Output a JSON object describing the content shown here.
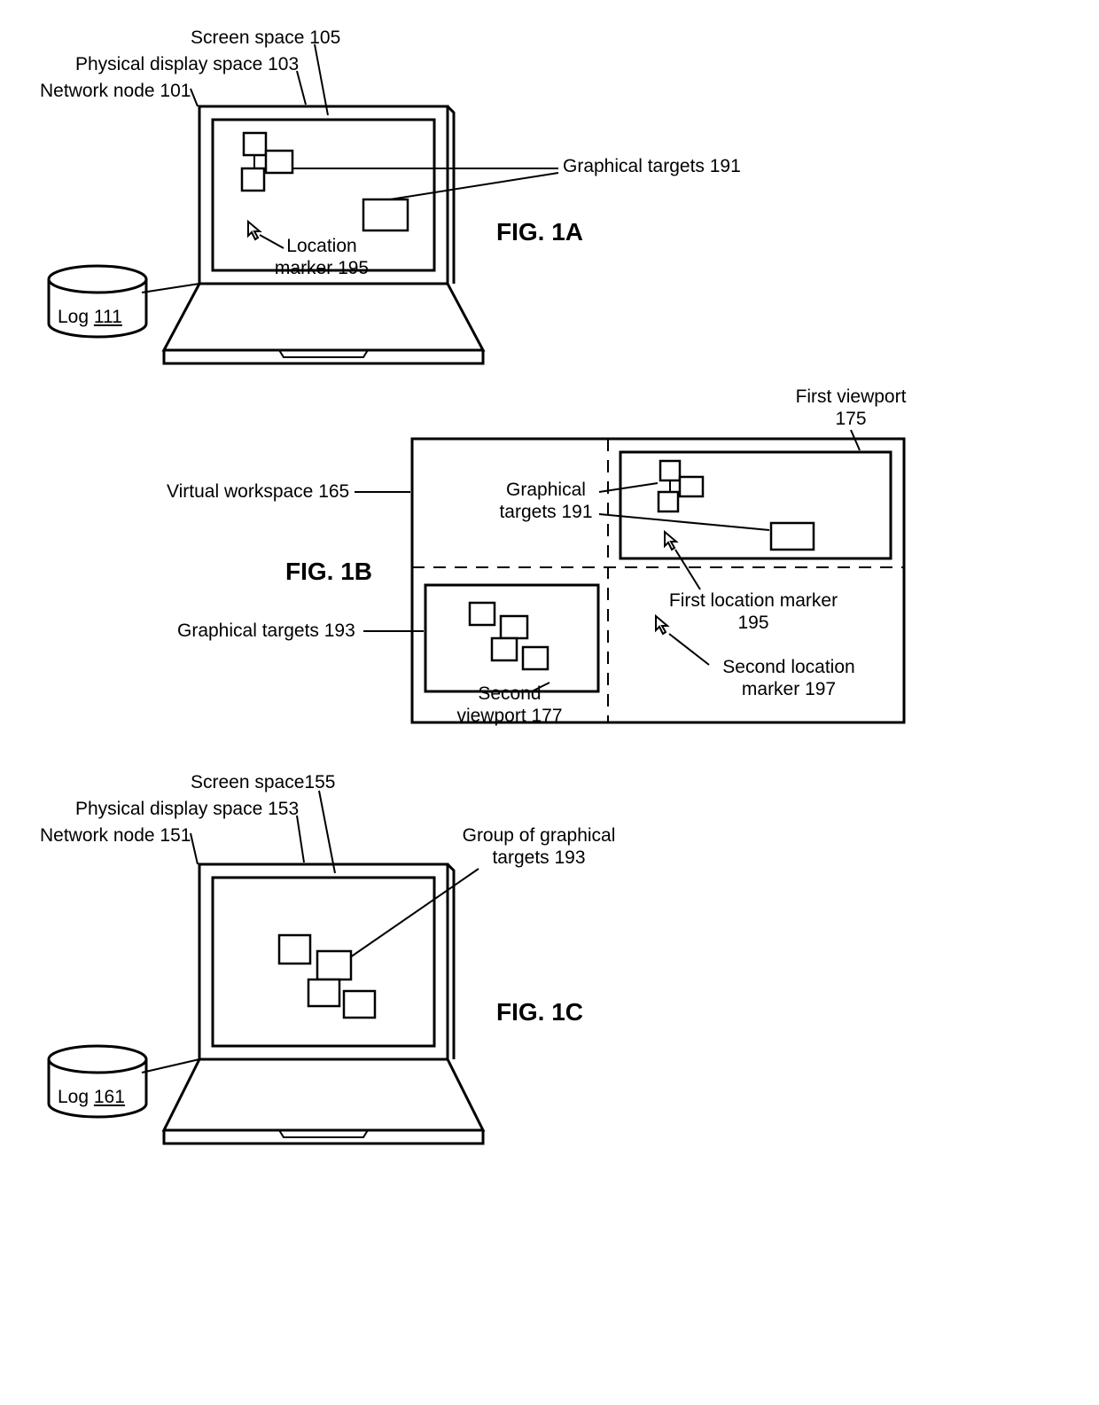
{
  "figA": {
    "title": "FIG. 1A",
    "labels": {
      "screen_space": "Screen space 105",
      "phys_display": "Physical display space 103",
      "net_node": "Network node 101",
      "graph_targets": "Graphical targets 191",
      "loc_marker_line1": "Location",
      "loc_marker_line2": "marker 195",
      "log_text": "Log ",
      "log_num": "111"
    }
  },
  "figB": {
    "title": "FIG. 1B",
    "labels": {
      "first_vp_line1": "First viewport",
      "first_vp_line2": "175",
      "virtual_ws": "Virtual workspace 165",
      "graph_targets191_line1": "Graphical",
      "graph_targets191_line2": "targets 191",
      "graph_targets193": "Graphical targets 193",
      "second_vp_line1": "Second",
      "second_vp_line2": "viewport 177",
      "first_loc_line1": "First location marker",
      "first_loc_line2": "195",
      "second_loc_line1": "Second location",
      "second_loc_line2": "marker 197"
    }
  },
  "figC": {
    "title": "FIG. 1C",
    "labels": {
      "screen_space": "Screen space155",
      "phys_display": "Physical display space 153",
      "net_node": "Network node 151",
      "group_line1": "Group of graphical",
      "group_line2": "targets 193",
      "log_text": "Log ",
      "log_num": "161"
    }
  }
}
